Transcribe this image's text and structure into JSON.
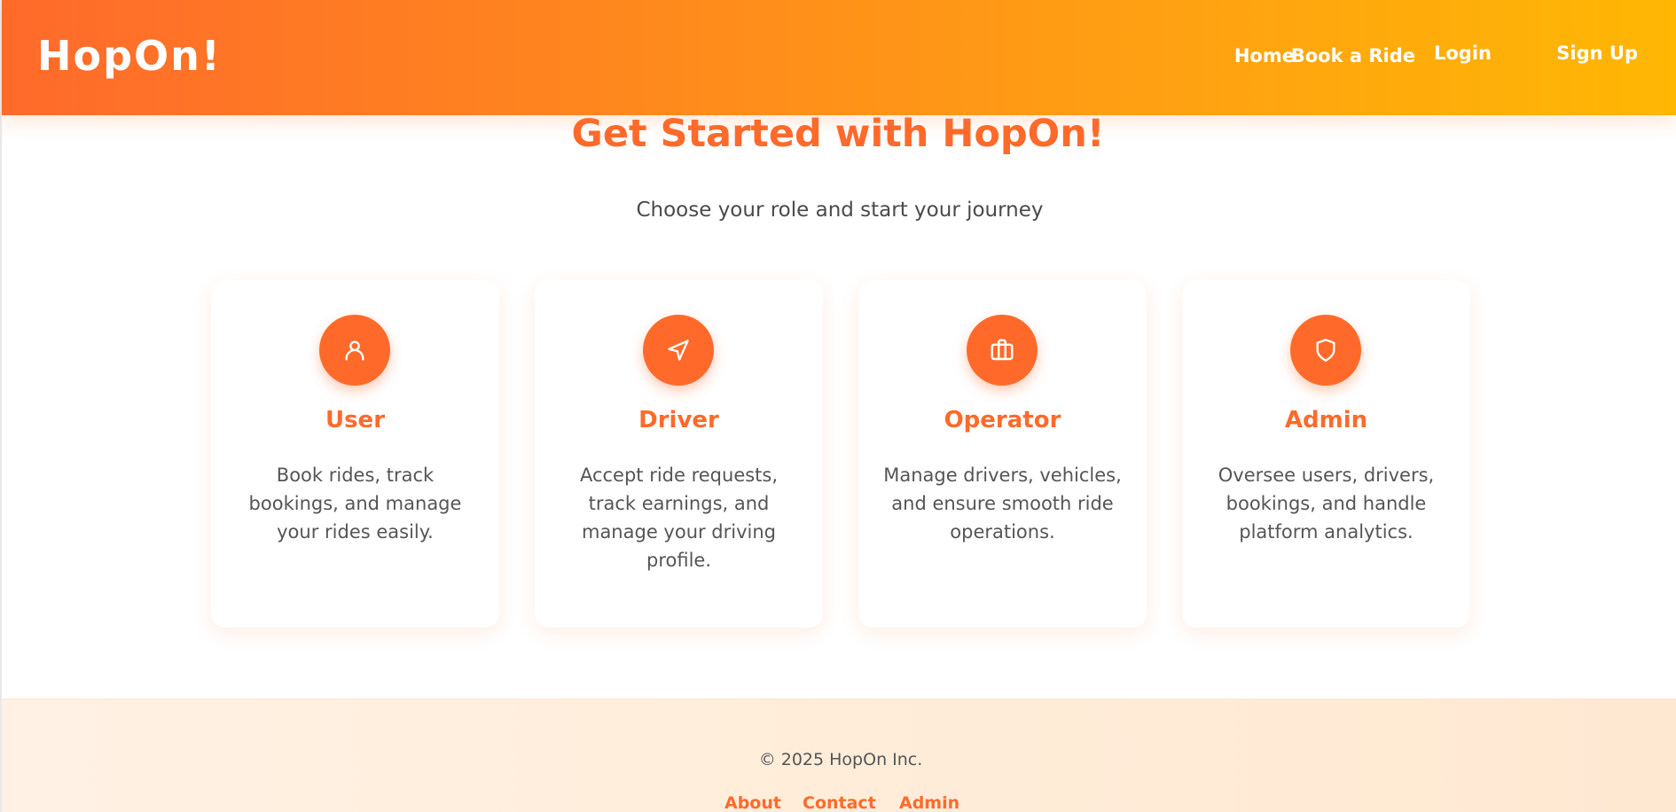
{
  "header": {
    "logo": "HopOn!",
    "nav": [
      "Home",
      "Book a Ride",
      "Login",
      "Sign Up"
    ]
  },
  "hero": {
    "title": "Get Started with HopOn!",
    "subtitle": "Choose your role and start your journey"
  },
  "roles": [
    {
      "icon": "user-icon",
      "title": "User",
      "description": "Book rides, track bookings, and manage your rides easily."
    },
    {
      "icon": "navigation-icon",
      "title": "Driver",
      "description": "Accept ride requests, track earnings, and manage your driving profile."
    },
    {
      "icon": "briefcase-icon",
      "title": "Operator",
      "description": "Manage drivers, vehicles, and ensure smooth ride operations."
    },
    {
      "icon": "shield-icon",
      "title": "Admin",
      "description": "Oversee users, drivers, bookings, and handle platform analytics."
    }
  ],
  "footer": {
    "copyright": "© 2025 HopOn Inc.",
    "links": [
      "About",
      "Contact",
      "Admin"
    ]
  },
  "colors": {
    "accent": "#ff6a2b",
    "header_gradient_start": "#ff6a2b",
    "header_gradient_end": "#ffb703",
    "footer_bg": "#fff1e4"
  }
}
